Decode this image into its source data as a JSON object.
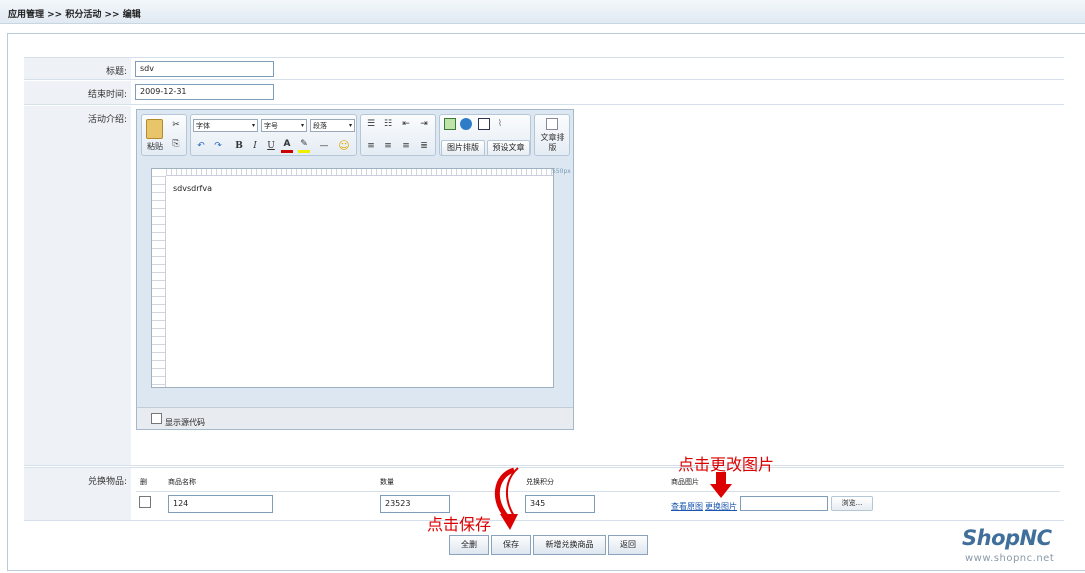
{
  "breadcrumb": "应用管理 >> 积分活动 >> 编辑",
  "form": {
    "title_label": "标题:",
    "title_value": "sdv",
    "end_label": "结束时间:",
    "end_value": "2009-12-31",
    "intro_label": "活动介绍:",
    "goods_label": "兑换物品:"
  },
  "editor": {
    "paste": "粘贴",
    "font_select": "字体",
    "size_select": "字号",
    "para_select": "段落",
    "img_layout_btn": "图片排版",
    "preset_btn": "预设文章",
    "article_btn": "文章排版",
    "width_hint": "550px",
    "content": "sdvsdrfva",
    "show_source": "显示源代码"
  },
  "goods": {
    "headers": [
      "删",
      "商品名称",
      "数量",
      "兑换积分",
      "商品图片"
    ],
    "row": {
      "name": "124",
      "qty": "23523",
      "points": "345"
    },
    "view_image": "查看原图",
    "change_image": "更换图片",
    "browse": "浏览..."
  },
  "buttons": {
    "delete_all": "全删",
    "save": "保存",
    "add_goods": "新增兑换商品",
    "back": "返回"
  },
  "notes": {
    "change_image": "点击更改图片",
    "save": "点击保存"
  },
  "logo": {
    "brand": "ShopNC",
    "url": "www.shopnc.net"
  },
  "colors": {
    "accent": "#1a56b0",
    "annotation": "#dd0000",
    "logo": "#3f6f9a"
  }
}
